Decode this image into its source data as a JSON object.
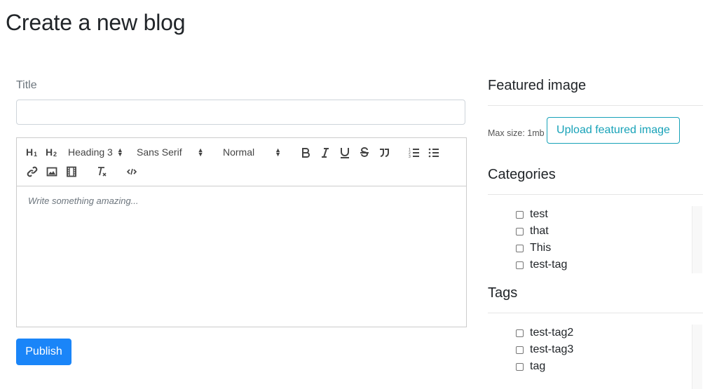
{
  "page": {
    "title": "Create a new blog"
  },
  "form": {
    "title_label": "Title",
    "title_value": "",
    "editor": {
      "placeholder": "Write something amazing...",
      "toolbar": {
        "h1": "H1",
        "h2": "H2",
        "header_select": "Heading 3",
        "font_select": "Sans Serif",
        "size_select": "Normal"
      }
    },
    "publish_label": "Publish"
  },
  "sidebar": {
    "featured_image": {
      "heading": "Featured image",
      "max_size": "Max size: 1mb",
      "upload_label": "Upload featured image"
    },
    "categories": {
      "heading": "Categories",
      "items": [
        {
          "label": "test",
          "checked": false
        },
        {
          "label": "that",
          "checked": false
        },
        {
          "label": "This",
          "checked": false
        },
        {
          "label": "test-tag",
          "checked": false
        }
      ]
    },
    "tags": {
      "heading": "Tags",
      "items": [
        {
          "label": "test-tag2",
          "checked": false
        },
        {
          "label": "test-tag3",
          "checked": false
        },
        {
          "label": "tag",
          "checked": false
        }
      ]
    }
  }
}
